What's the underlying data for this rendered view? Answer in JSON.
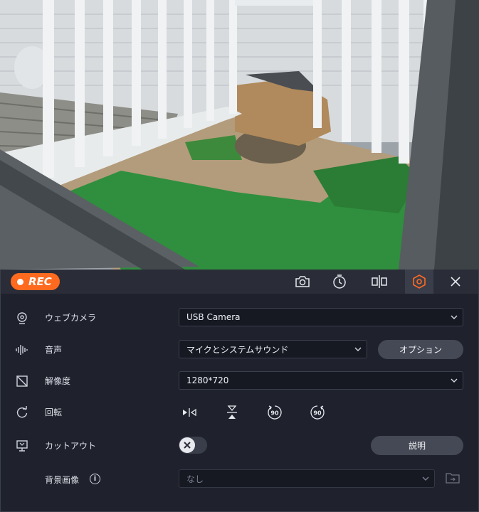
{
  "toolbar": {
    "rec_label": "REC",
    "icons": [
      "camera-snapshot-icon",
      "timer-icon",
      "mirror-icon",
      "hexagon-settings-icon",
      "close-icon"
    ],
    "accent_color": "#ff6a1f"
  },
  "settings": {
    "webcam": {
      "label": "ウェブカメラ",
      "value": "USB Camera"
    },
    "audio": {
      "label": "音声",
      "value": "マイクとシステムサウンド",
      "options_button": "オプション"
    },
    "resolution": {
      "label": "解像度",
      "value": "1280*720"
    },
    "rotation": {
      "label": "回転",
      "rotate_left_label": "90",
      "rotate_right_label": "90"
    },
    "cutout": {
      "label": "カットアウト",
      "enabled": false,
      "help_button": "説明"
    },
    "background": {
      "label": "背景画像",
      "info": "i",
      "value": "なし"
    }
  }
}
